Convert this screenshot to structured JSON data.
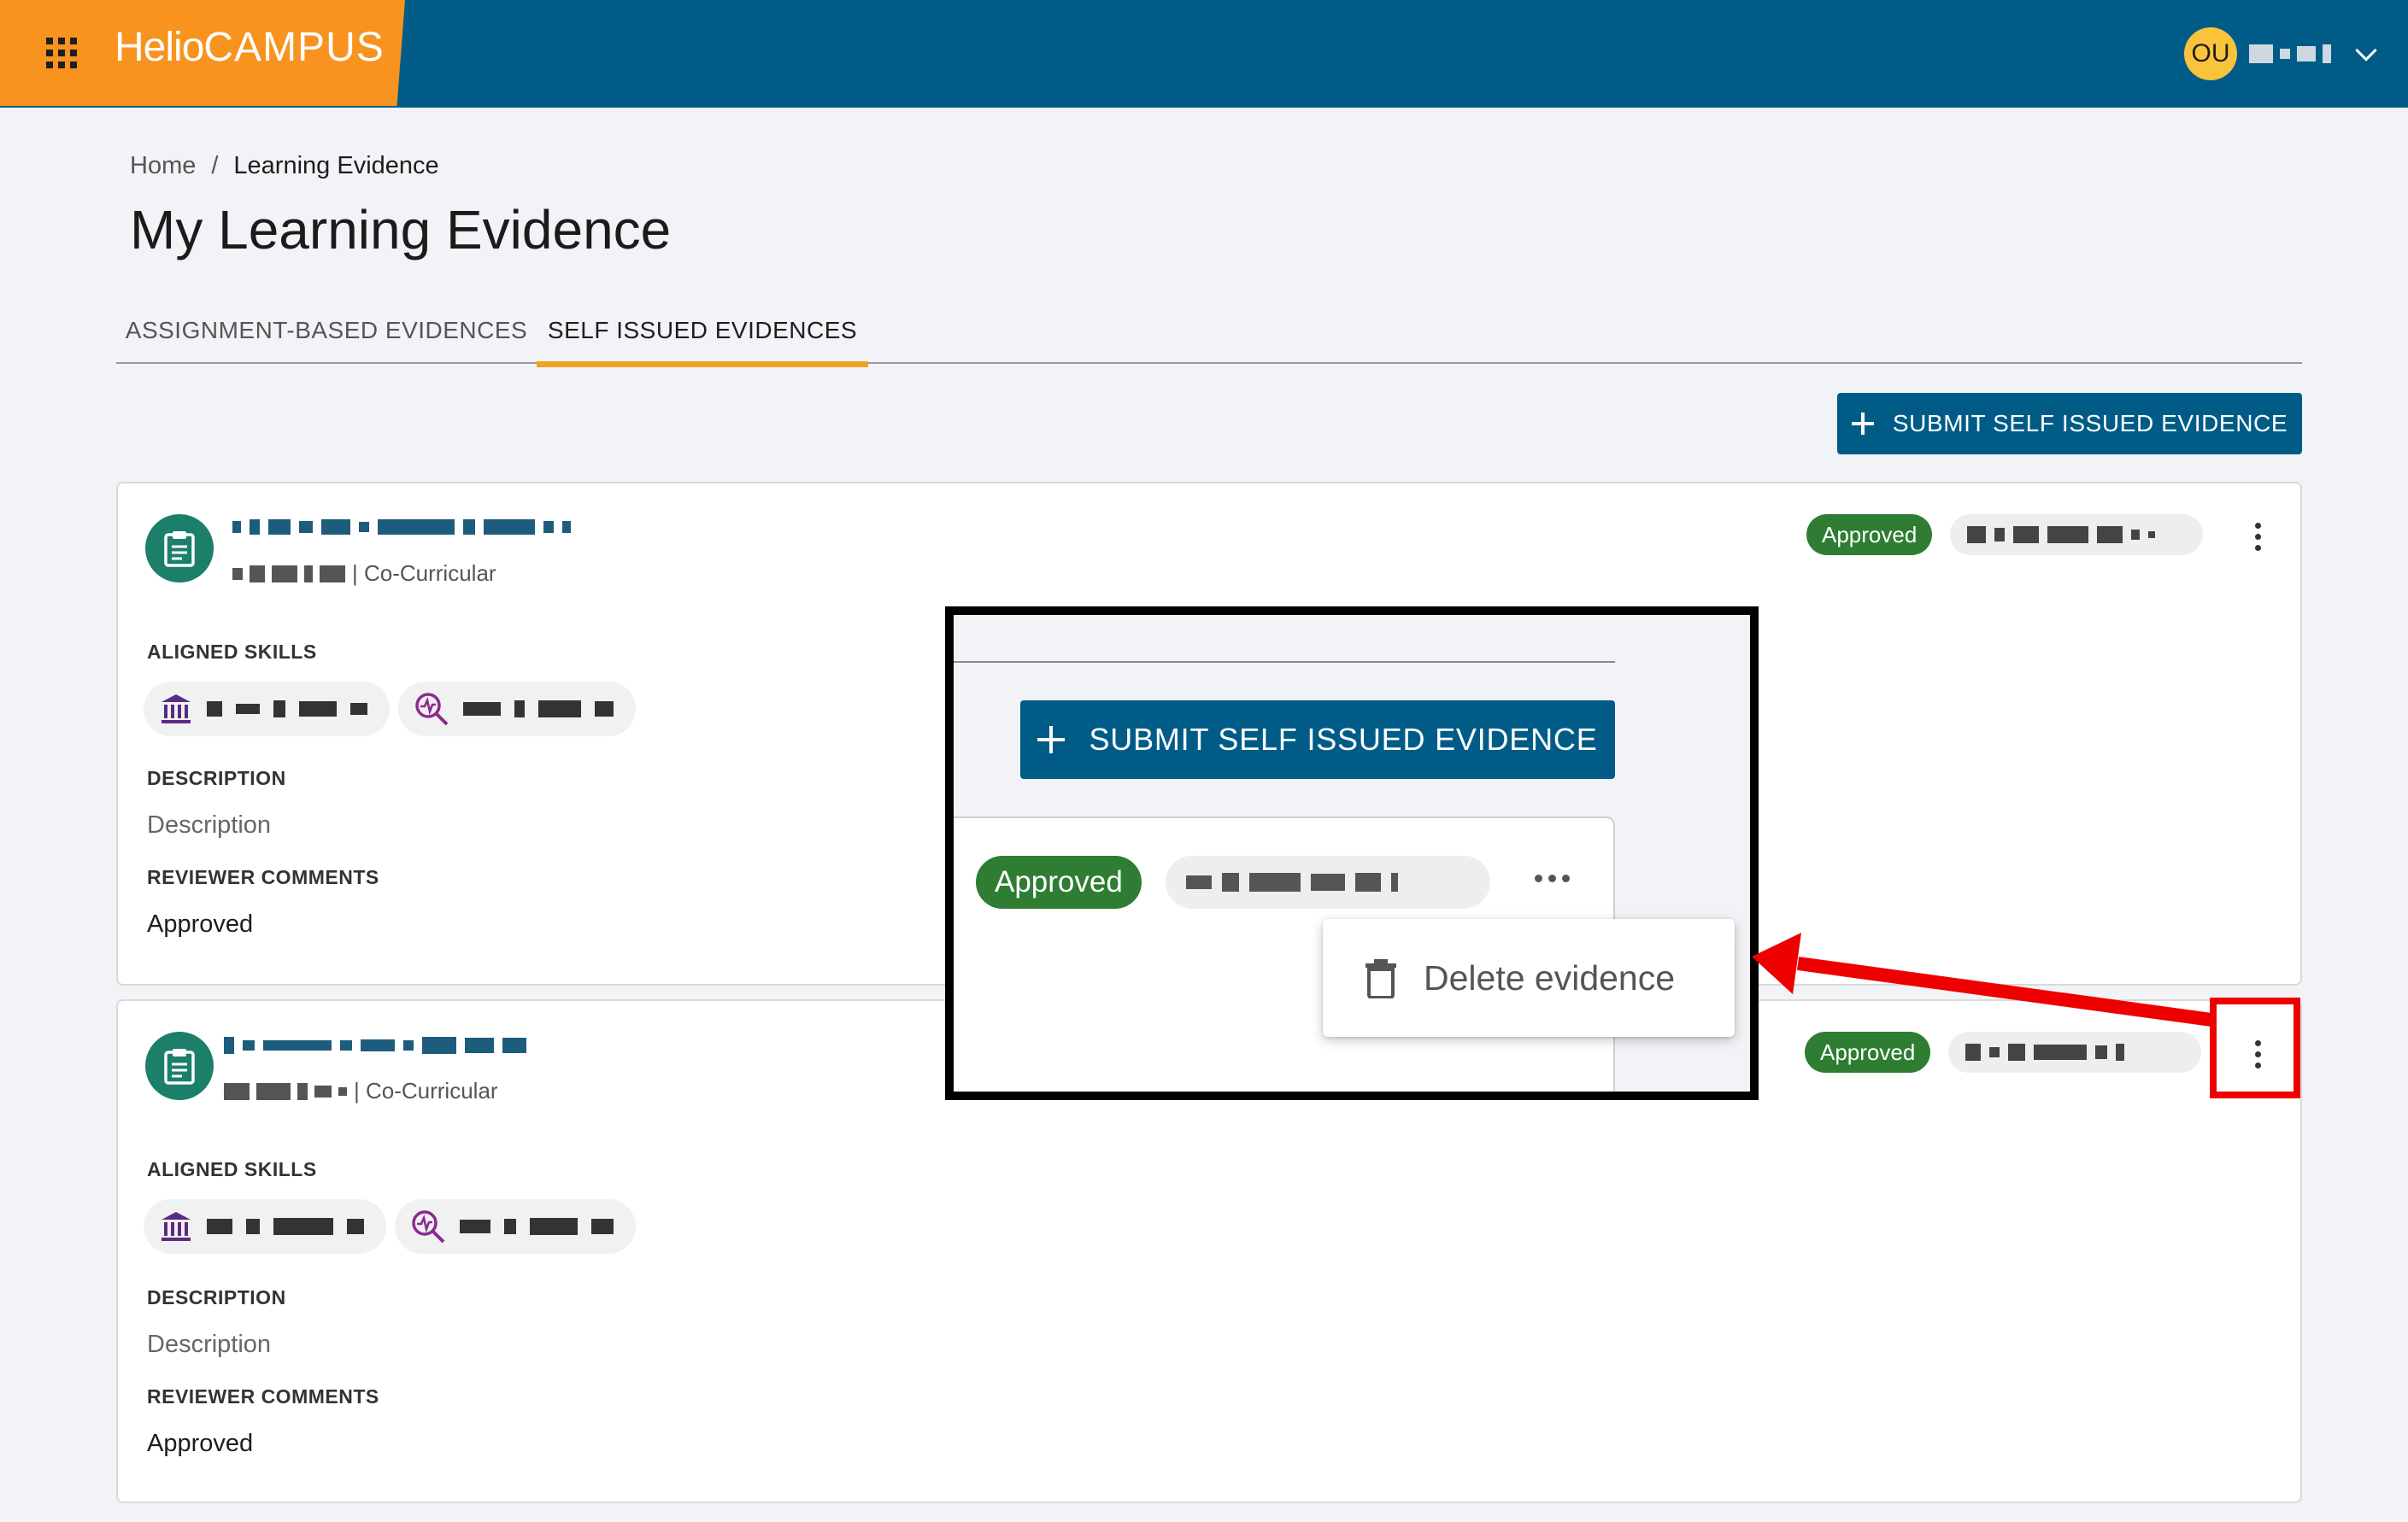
{
  "header": {
    "logo_part1": "Helio",
    "logo_part2": "CAMPUS",
    "user_initials": "OU",
    "apps_icon": "apps-grid-icon",
    "dropdown_icon": "chevron-down-icon"
  },
  "breadcrumb": {
    "home": "Home",
    "separator": "/",
    "current": "Learning Evidence"
  },
  "page_title": "My Learning Evidence",
  "tabs": [
    {
      "label": "ASSIGNMENT-BASED EVIDENCES",
      "active": false
    },
    {
      "label": "SELF ISSUED EVIDENCES",
      "active": true
    }
  ],
  "submit_button": {
    "label": "SUBMIT SELF ISSUED EVIDENCE",
    "icon": "plus-icon"
  },
  "cards": [
    {
      "category": "| Co-Curricular",
      "aligned_skills_label": "ALIGNED SKILLS",
      "description_label": "DESCRIPTION",
      "description": "Description",
      "reviewer_comments_label": "REVIEWER COMMENTS",
      "reviewer_comment": "Approved",
      "status": "Approved",
      "icon": "clipboard-icon",
      "menu_icon": "more-vertical-icon"
    },
    {
      "category": "| Co-Curricular",
      "aligned_skills_label": "ALIGNED SKILLS",
      "description_label": "DESCRIPTION",
      "description": "Description",
      "reviewer_comments_label": "REVIEWER COMMENTS",
      "reviewer_comment": "Approved",
      "status": "Approved",
      "icon": "clipboard-icon",
      "menu_icon": "more-vertical-icon"
    }
  ],
  "zoom_inset": {
    "submit_label": "SUBMIT SELF ISSUED EVIDENCE",
    "status": "Approved",
    "menu_icon": "more-horizontal-icon",
    "delete_label": "Delete evidence",
    "delete_icon": "trash-icon"
  },
  "colors": {
    "topbar": "#005c87",
    "brand": "#f7931e",
    "tab_indicator": "#f0a026",
    "approved": "#2e7d32",
    "annotation": "#ee0000"
  }
}
